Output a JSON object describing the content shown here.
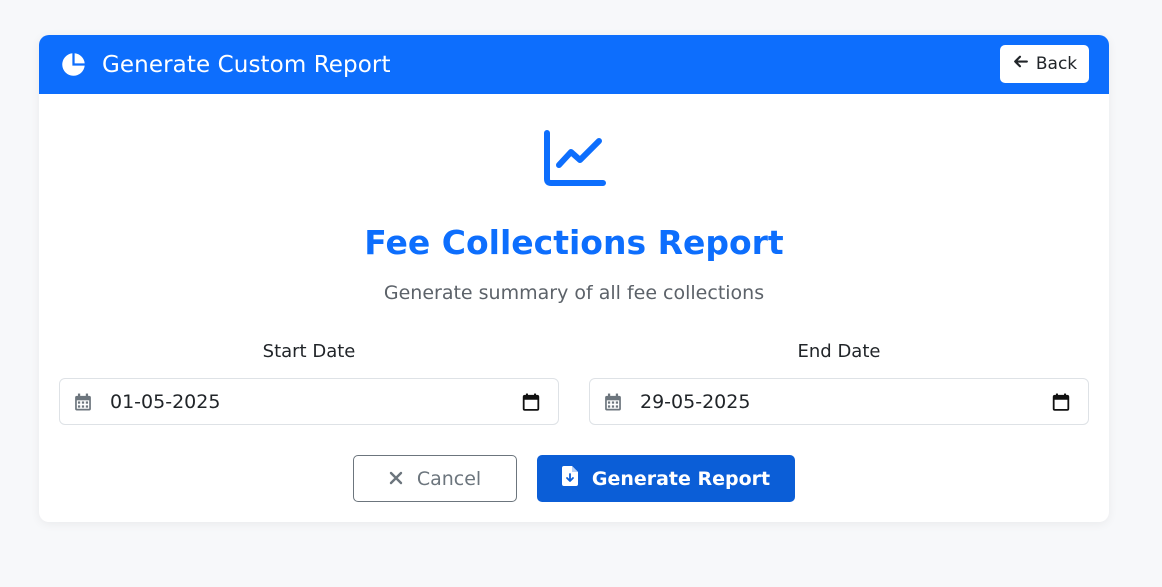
{
  "header": {
    "title": "Generate Custom Report",
    "back_label": "Back"
  },
  "report": {
    "title": "Fee Collections Report",
    "subtitle": "Generate summary of all fee collections"
  },
  "fields": {
    "start": {
      "label": "Start Date",
      "value": "01-05-2025"
    },
    "end": {
      "label": "End Date",
      "value": "29-05-2025"
    }
  },
  "actions": {
    "cancel_label": "Cancel",
    "generate_label": "Generate Report"
  },
  "icons": {
    "header": "pie-chart-icon",
    "back": "arrow-left-icon",
    "hero": "line-chart-icon",
    "calendar": "calendar-icon",
    "cancel": "close-icon",
    "generate": "file-download-icon"
  },
  "colors": {
    "primary": "#0d6efd",
    "primary_dark": "#0b5ed7",
    "muted": "#6c757d",
    "page_bg": "#f7f8fa"
  }
}
